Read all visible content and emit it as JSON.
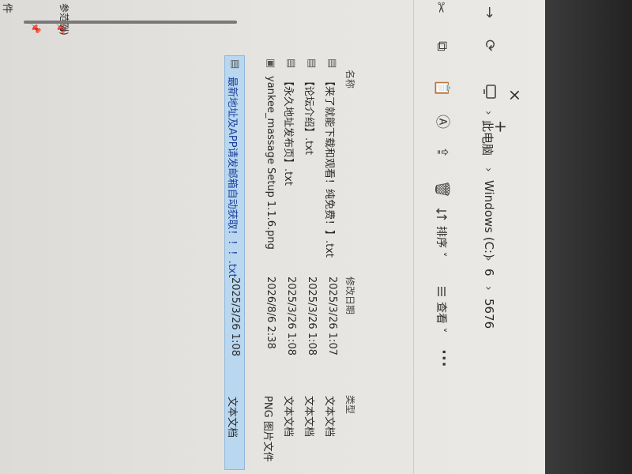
{
  "tabs": {
    "close_icon": "×",
    "new_tab_icon": "+"
  },
  "nav": {
    "forward_icon": "→",
    "refresh_icon": "⟳",
    "breadcrumb": [
      "此电脑",
      "Windows (C:)",
      "6",
      "5676"
    ],
    "separator": "›"
  },
  "toolbar": {
    "cut_icon": "✂",
    "copy_icon": "⧉",
    "paste_icon": "📋",
    "rename_icon": "Ⓐ",
    "share_icon": "⇪",
    "delete_icon": "🗑",
    "sort_label": "排序 ˅",
    "view_label": "查看 ˅",
    "more_label": "···"
  },
  "left_panel": {
    "label_1": "件",
    "label_2": "参范例)"
  },
  "columns": {
    "name": "名称",
    "date": "修改日期",
    "type": "类型"
  },
  "files": [
    {
      "name": "【来了就能下载和观看！纯免费！】.txt",
      "date": "2025/3/26 1:07",
      "type": "文本文档",
      "icon": "txt"
    },
    {
      "name": "【论坛介绍】.txt",
      "date": "2025/3/26 1:08",
      "type": "文本文档",
      "icon": "txt"
    },
    {
      "name": "【永久地址发布页】.txt",
      "date": "2025/3/26 1:08",
      "type": "文本文档",
      "icon": "txt"
    },
    {
      "name": "yankee_massage Setup 1.1.6.png",
      "date": "2026/8/6 2:38",
      "type": "PNG 图片文件",
      "icon": "png"
    },
    {
      "name": "最新地址及APP请发邮箱自动获取！！！.txt",
      "date": "2025/3/26 1:08",
      "type": "文本文档",
      "icon": "txt",
      "selected": true
    }
  ],
  "colors": {
    "selection": "#b9d7ef",
    "selected_text": "#1b3e9a"
  }
}
